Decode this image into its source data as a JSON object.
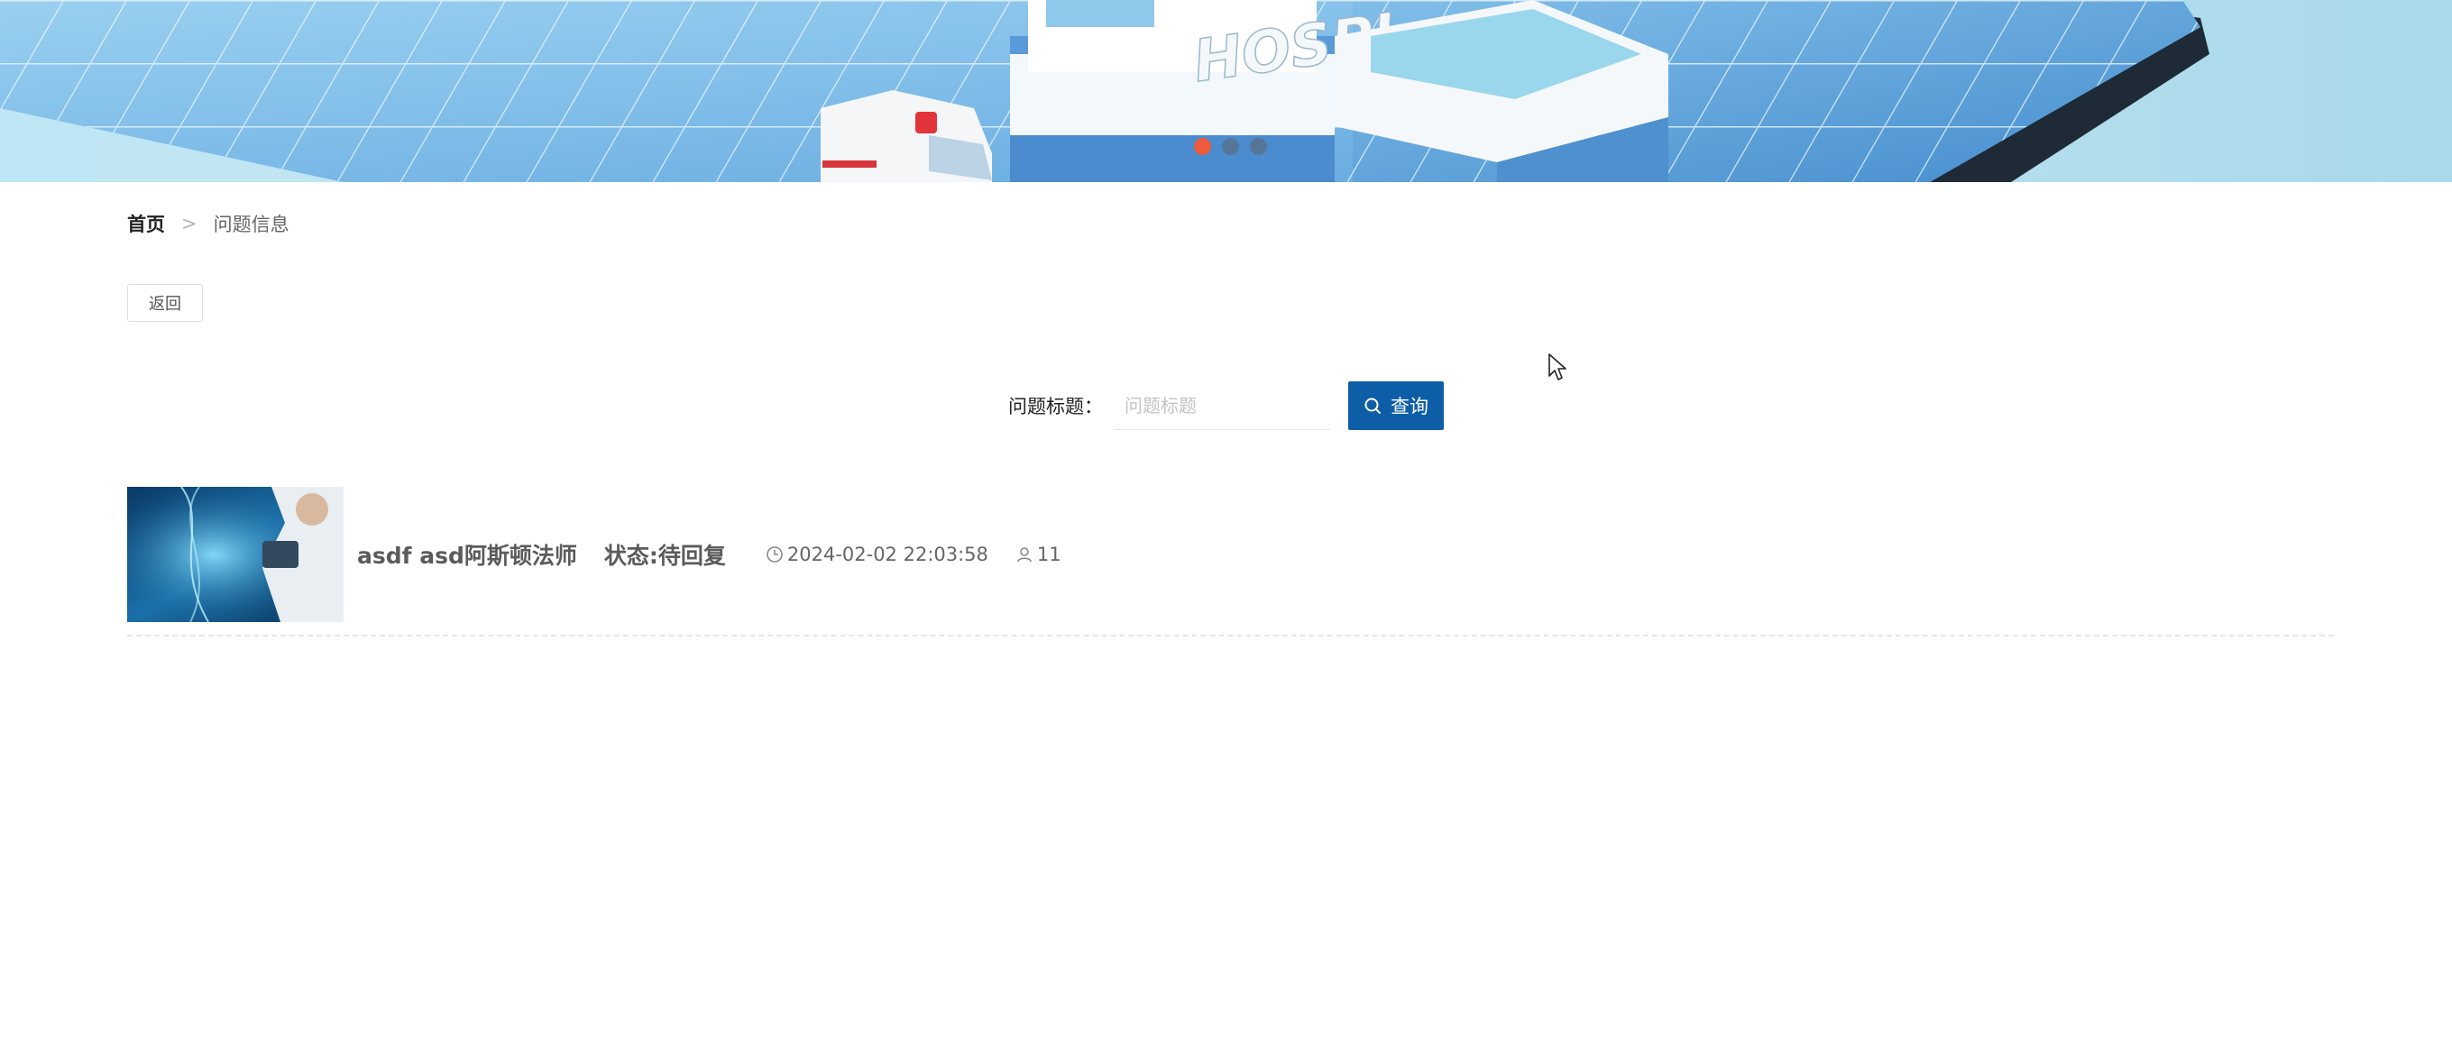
{
  "banner": {
    "sign_text": "HOSPI",
    "slide_count": 3,
    "active_slide": 1
  },
  "breadcrumb": {
    "home": "首页",
    "separator": ">",
    "current": "问题信息"
  },
  "back_button": {
    "label": "返回"
  },
  "search": {
    "label": "问题标题：",
    "placeholder": "问题标题",
    "value": "",
    "button_label": "查询"
  },
  "items": [
    {
      "title": "asdf asd阿斯顿法师",
      "status": "状态:待回复",
      "datetime": "2024-02-02 22:03:58",
      "views": "11"
    }
  ],
  "icons": {
    "search": "search-icon",
    "clock": "clock-icon",
    "user": "user-icon",
    "cursor": "mouse-cursor-icon"
  },
  "colors": {
    "primary_button": "#0d5ea7",
    "active_dot": "#ee5a3c",
    "inactive_dot": "#5a6f86",
    "text_muted": "#666666",
    "divider": "#e8e8e8"
  }
}
